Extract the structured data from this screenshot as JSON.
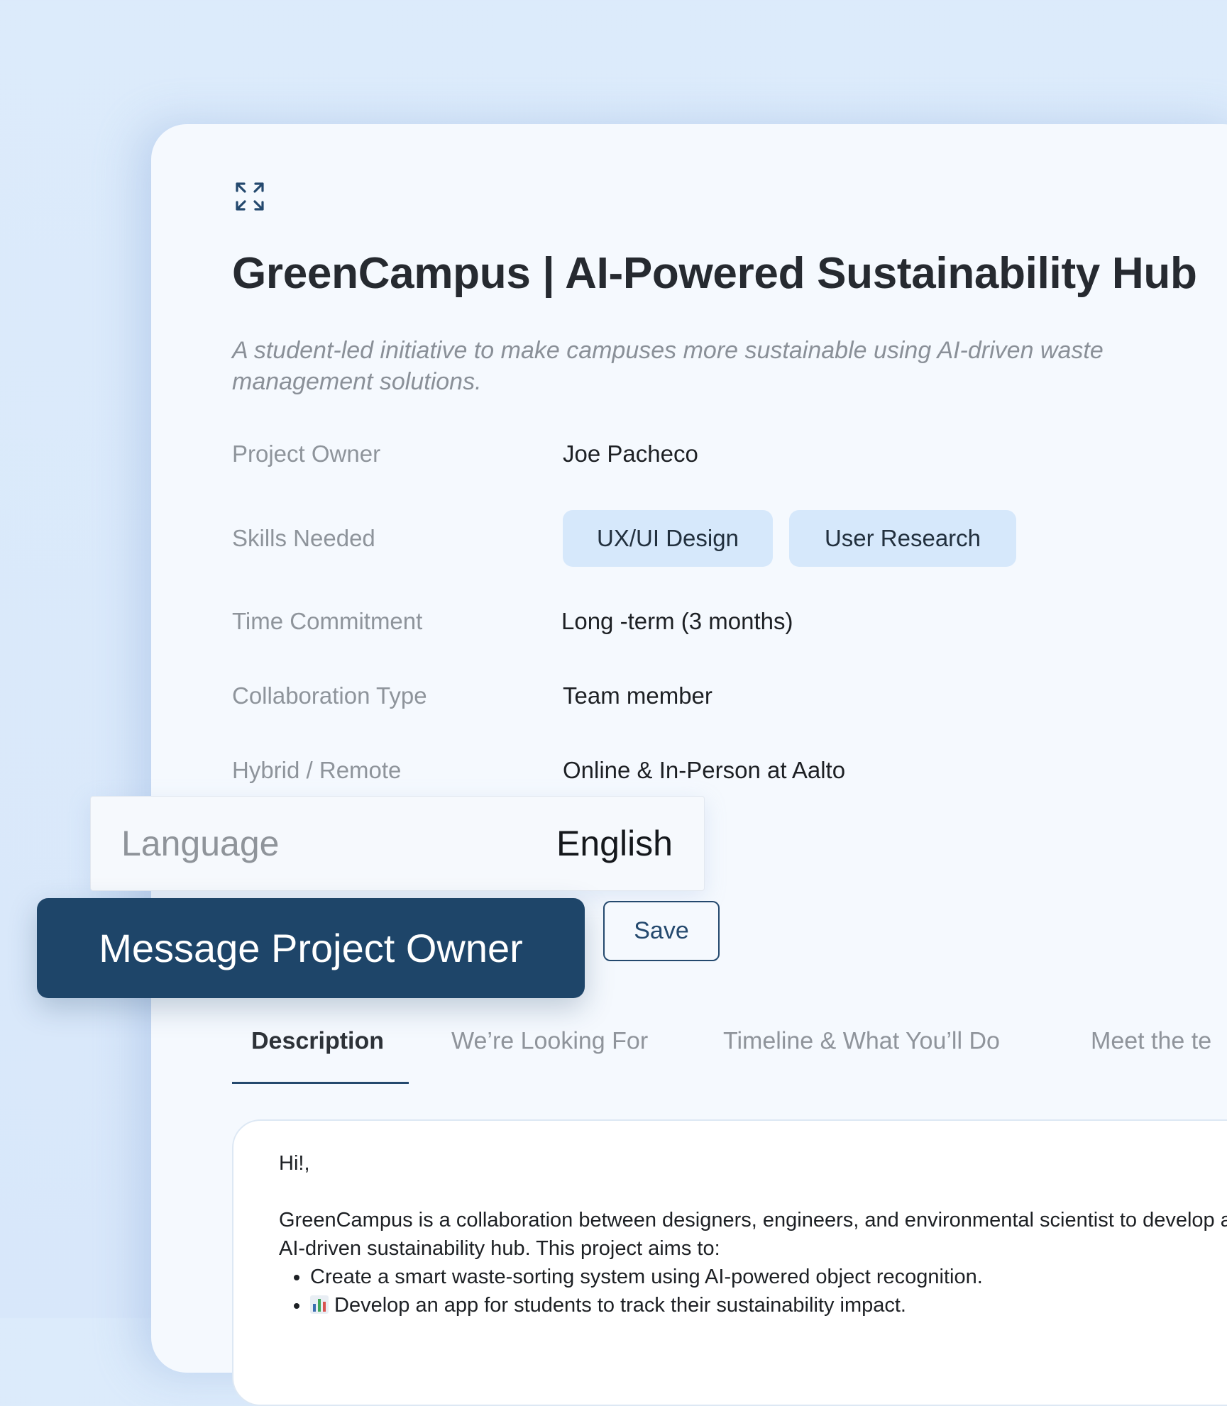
{
  "project": {
    "title": "GreenCampus | AI-Powered Sustainability Hub",
    "subtitle": "A student-led initiative to make campuses more sustainable using AI-driven waste management solutions."
  },
  "details": {
    "owner_label": "Project Owner",
    "owner_value": "Joe Pacheco",
    "skills_label": "Skills Needed",
    "skills": [
      "UX/UI Design",
      "User Research"
    ],
    "time_label": "Time Commitment",
    "time_value": "Long -term (3 months)",
    "collab_label": "Collaboration Type",
    "collab_value": "Team member",
    "hybrid_label": "Hybrid / Remote",
    "hybrid_value": "Online & In-Person at Aalto"
  },
  "language": {
    "label": "Language",
    "value": "English"
  },
  "actions": {
    "message_label": "Message Project Owner",
    "save_label": "Save"
  },
  "tabs": [
    "Description",
    "We’re Looking For",
    "Timeline & What You’ll Do",
    "Meet the te"
  ],
  "description": {
    "greeting": "Hi!,",
    "intro": "GreenCampus is a collaboration between designers, engineers, and environmental scientist to develop an AI-driven sustainability hub. This project aims to:",
    "bullets": [
      "Create a smart waste-sorting system using AI-powered object recognition.",
      "Develop an app for students to track their sustainability impact."
    ]
  },
  "colors": {
    "primary": "#1e4569",
    "chip_bg": "#d6e8fb",
    "page_bg": "#dcebfb",
    "card_bg": "#f5f9fe"
  },
  "icons": {
    "expand": "expand-icon",
    "bullet2": "bar-chart-icon"
  }
}
